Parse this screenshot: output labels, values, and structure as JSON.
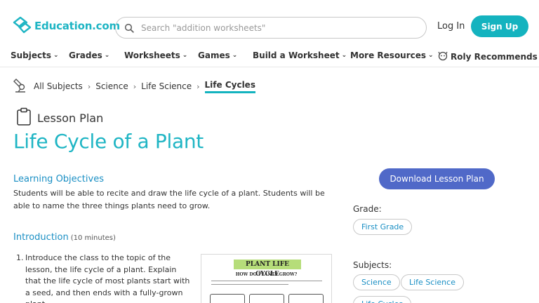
{
  "header": {
    "logo_text": "Education.com",
    "search_placeholder": "Search \"addition worksheets\"",
    "login_label": "Log In",
    "signup_label": "Sign Up"
  },
  "nav": {
    "items": [
      {
        "label": "Subjects"
      },
      {
        "label": "Grades"
      },
      {
        "label": "Worksheets"
      },
      {
        "label": "Games"
      },
      {
        "label": "Build a Worksheet"
      },
      {
        "label": "More Resources"
      },
      {
        "label": "Roly Recommends"
      }
    ]
  },
  "breadcrumb": {
    "items": [
      "All Subjects",
      "Science",
      "Life Science"
    ],
    "current": "Life Cycles"
  },
  "page": {
    "type_label": "Lesson Plan",
    "title": "Life Cycle of a Plant"
  },
  "learning_objectives": {
    "title": "Learning Objectives",
    "text": "Students will be able to recite and draw the life cycle of a plant. Students will be able to name the three things plants need to grow."
  },
  "introduction": {
    "title": "Introduction",
    "duration": "(10 minutes)",
    "step_number": "1.",
    "step_text": "Introduce the class to the topic of the lesson, the life cycle of a plant. Explain that the life cycle of most plants start with a seed, and then ends with a fully-grown plant."
  },
  "worksheet_preview": {
    "title": "PLANT LIFE CYCLE",
    "subtitle": "HOW DO PLANTS GROW?"
  },
  "sidebar": {
    "download_label": "Download Lesson Plan",
    "grade_label": "Grade:",
    "grades": [
      "First Grade"
    ],
    "subjects_label": "Subjects:",
    "subjects": [
      "Science",
      "Life Science",
      "Life Cycles"
    ]
  },
  "colors": {
    "brand_teal": "#1fb5c4",
    "signup_bg": "#14b3bf",
    "download_bg": "#5069c8",
    "link_blue": "#1a8fc4"
  }
}
